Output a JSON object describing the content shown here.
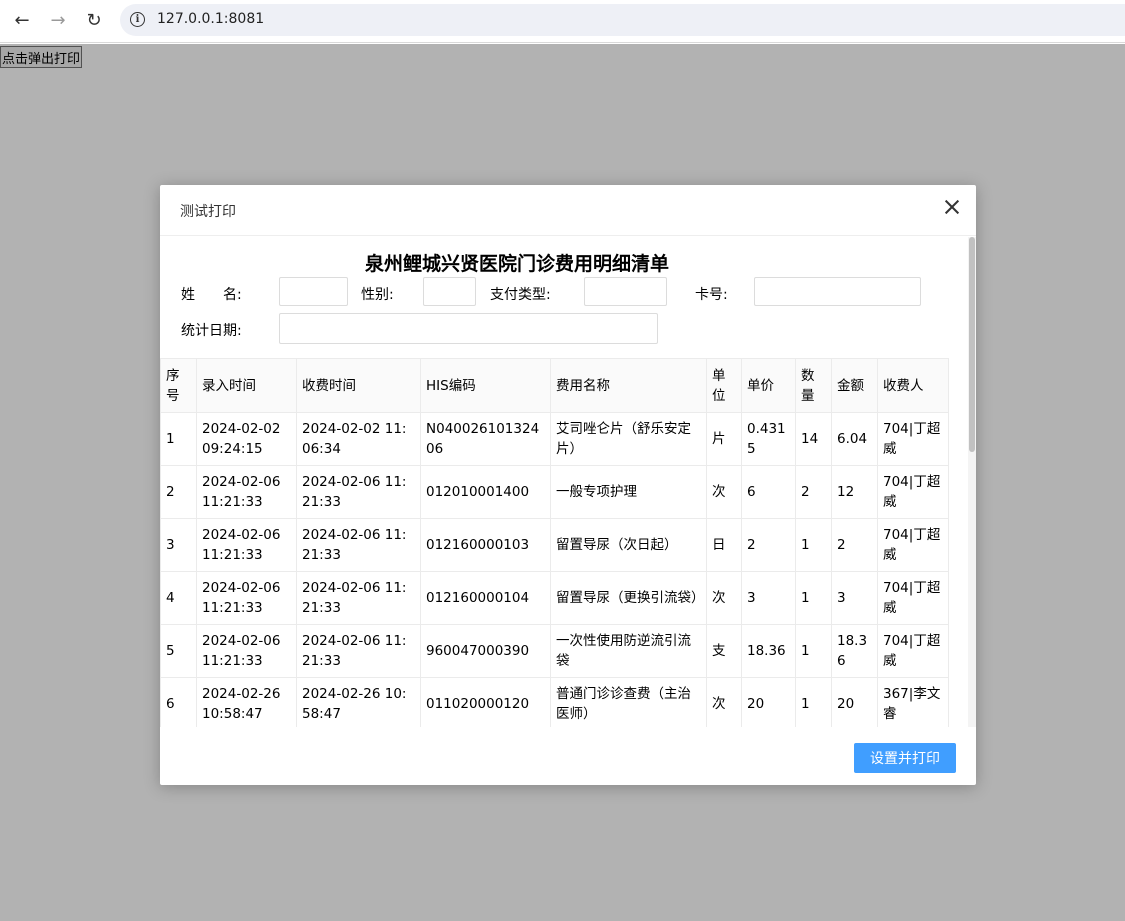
{
  "browser": {
    "url": "127.0.0.1:8081"
  },
  "page": {
    "popup_button_label": "点击弹出打印"
  },
  "dialog": {
    "title": "测试打印",
    "bill_title": "泉州鲤城兴贤医院门诊费用明细清单",
    "fields": {
      "name_label": "姓　　名:",
      "gender_label": "性别:",
      "payment_type_label": "支付类型:",
      "card_label": "卡号:",
      "stat_date_label": "统计日期:"
    },
    "table": {
      "headers": [
        "序号",
        "录入时间",
        "收费时间",
        "HIS编码",
        "费用名称",
        "单位",
        "单价",
        "数量",
        "金额",
        "收费人"
      ],
      "rows": [
        [
          "1",
          "2024-02-02 09:24:15",
          "2024-02-02 11:06:34",
          "N04002610132406",
          "艾司唑仑片（舒乐安定片）",
          "片",
          "0.4315",
          "14",
          "6.04",
          "704|丁超威"
        ],
        [
          "2",
          "2024-02-06 11:21:33",
          "2024-02-06 11:21:33",
          "012010001400",
          "一般专项护理",
          "次",
          "6",
          "2",
          "12",
          "704|丁超威"
        ],
        [
          "3",
          "2024-02-06 11:21:33",
          "2024-02-06 11:21:33",
          "012160000103",
          "留置导尿（次日起）",
          "日",
          "2",
          "1",
          "2",
          "704|丁超威"
        ],
        [
          "4",
          "2024-02-06 11:21:33",
          "2024-02-06 11:21:33",
          "012160000104",
          "留置导尿（更换引流袋）",
          "次",
          "3",
          "1",
          "3",
          "704|丁超威"
        ],
        [
          "5",
          "2024-02-06 11:21:33",
          "2024-02-06 11:21:33",
          "960047000390",
          "一次性使用防逆流引流袋",
          "支",
          "18.36",
          "1",
          "18.36",
          "704|丁超威"
        ],
        [
          "6",
          "2024-02-26 10:58:47",
          "2024-02-26 10:58:47",
          "011020000120",
          "普通门诊诊查费（主治医师）",
          "次",
          "20",
          "1",
          "20",
          "367|李文睿"
        ]
      ]
    },
    "print_button_label": "设置并打印"
  }
}
